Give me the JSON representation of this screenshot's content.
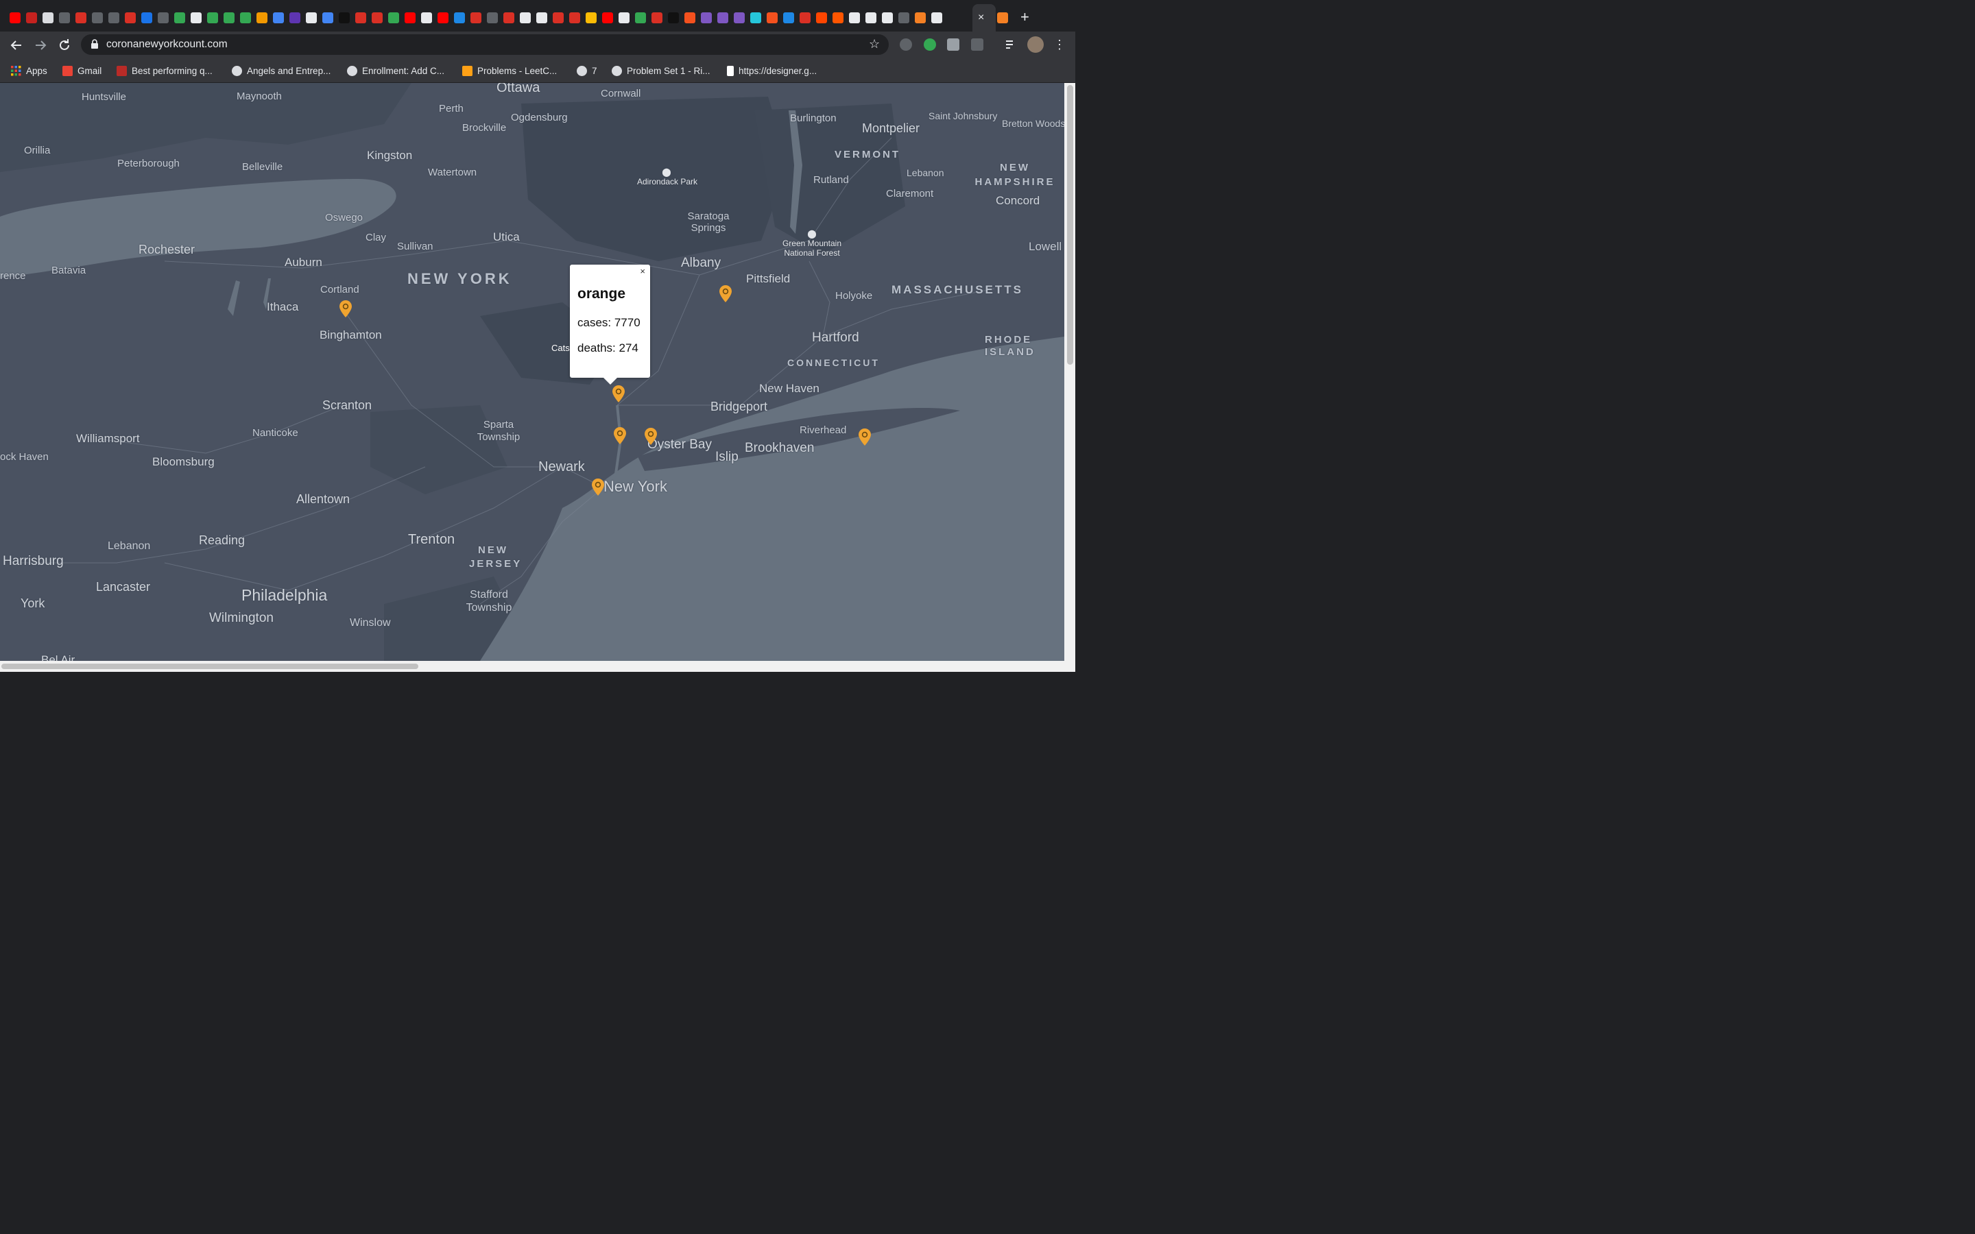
{
  "browser": {
    "url": "coronanewyorkcount.com",
    "new_tab_glyph": "+",
    "tab_close_glyph": "×",
    "bookmarks": [
      {
        "label": "Apps",
        "icon": "apps-grid-icon"
      },
      {
        "label": "Gmail",
        "icon": "gmail-icon"
      },
      {
        "label": "Best performing q...",
        "icon": "quora-icon"
      },
      {
        "label": "Angels and Entrep...",
        "icon": "globe-icon"
      },
      {
        "label": "Enrollment: Add C...",
        "icon": "globe-icon"
      },
      {
        "label": "Problems - LeetC...",
        "icon": "leetcode-icon"
      },
      {
        "label": "7",
        "icon": "globe-icon"
      },
      {
        "label": "Problem Set 1 - Ri...",
        "icon": "globe-icon"
      },
      {
        "label": "https://designer.g...",
        "icon": "designer-icon"
      }
    ]
  },
  "map": {
    "labels": {
      "ottawa": "Ottawa",
      "huntsville": "Huntsville",
      "maynooth": "Maynooth",
      "cornwall": "Cornwall",
      "perth": "Perth",
      "ogdensburg": "Ogdensburg",
      "brockville": "Brockville",
      "burlington": "Burlington",
      "montpelier": "Montpelier",
      "saint_johnsbury": "Saint Johnsbury",
      "bretton_woods": "Bretton Woods",
      "orillia": "Orillia",
      "peterborough": "Peterborough",
      "belleville": "Belleville",
      "kingston": "Kingston",
      "watertown": "Watertown",
      "adirondack": "Adirondack Park",
      "vermont": "VERMONT",
      "rutland": "Rutland",
      "lebanon_nh": "Lebanon",
      "new_hampshire": "NEW HAMPSHIRE",
      "claremont": "Claremont",
      "concord": "Concord",
      "oswego": "Oswego",
      "saratoga": "Saratoga Springs",
      "green_mountain": "Green Mountain National Forest",
      "lowell": "Lowell",
      "rochester": "Rochester",
      "clay": "Clay",
      "sullivan": "Sullivan",
      "utica": "Utica",
      "batavia": "Batavia",
      "auburn": "Auburn",
      "albany": "Albany",
      "new_york_state": "NEW YORK",
      "pittsfield": "Pittsfield",
      "massachusetts": "MASSACHUSETTS",
      "lawrence": "rence",
      "cortland": "Cortland",
      "holyoke": "Holyoke",
      "ithaca": "Ithaca",
      "binghamton": "Binghamton",
      "hartford": "Hartford",
      "rhode_island": "RHODE ISLAND",
      "catskill": "Catsk",
      "connecticut": "CONNECTICUT",
      "new_haven": "New Haven",
      "scranton": "Scranton",
      "bridgeport": "Bridgeport",
      "sparta": "Sparta Township",
      "riverhead": "Riverhead",
      "williamsport": "Williamsport",
      "nanticoke": "Nanticoke",
      "oyster_bay": "Oyster Bay",
      "brookhaven": "Brookhaven",
      "lock_haven": "ock Haven",
      "bloomsburg": "Bloomsburg",
      "islip": "Islip",
      "newark": "Newark",
      "new_york_city": "New York",
      "allentown": "Allentown",
      "reading": "Reading",
      "lebanon_pa": "Lebanon",
      "trenton": "Trenton",
      "new_jersey": "NEW JERSEY",
      "harrisburg": "Harrisburg",
      "lancaster": "Lancaster",
      "stafford": "Stafford Township",
      "philadelphia": "Philadelphia",
      "york": "York",
      "wilmington": "Wilmington",
      "winslow": "Winslow",
      "bel_air": "Bel Air"
    },
    "popup": {
      "county": "orange",
      "cases_text": "cases: 7770",
      "deaths_text": "deaths: 274",
      "close": "×"
    }
  }
}
